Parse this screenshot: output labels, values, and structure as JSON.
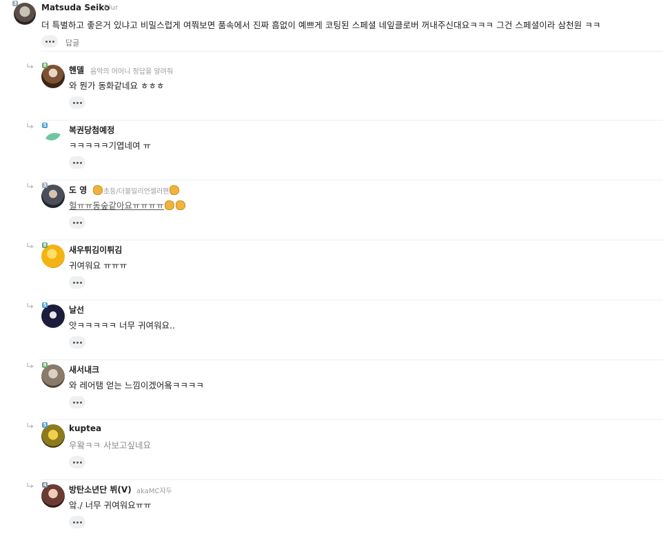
{
  "parent": {
    "nickname": "Matsuda Seiko",
    "nick_tag": "Blur",
    "level": "3",
    "text": "더 특별하고 좋은거 있냐고 비밀스럽게 여쭤보면 품속에서 진짜 흠없이 예쁘게 코팅된 스페셜 네잎클로버 꺼내주신대요ㅋㅋㅋ 그건 스페셜이라 삼천원 ㅋㅋ",
    "reply_label": "답글",
    "avatar_icon": "user-avatar"
  },
  "replies": [
    {
      "nickname": "헨델",
      "nick_tag": "음악의 어머니 정답을 알려줘",
      "level": "8",
      "text": "와 뭔가 동화같네요 ㅎㅎㅎ",
      "avatar_color": "#5a3a22",
      "avatar_icon": "user-avatar"
    },
    {
      "nickname": "복권당첨예정",
      "nick_tag": "",
      "level": "5",
      "text": "ㅋㅋㅋㅋㅋ기엽네여 ㅠ",
      "avatar_color": "#6fc7a1",
      "avatar_icon": "leaf-avatar"
    },
    {
      "nickname": "도 영",
      "nick_tag": "초등/더블밀리언셀러팬",
      "level": "3",
      "text": "헐ㅠㅠ동숲같아요ㅠㅠㅠㅠ",
      "avatar_color": "#3a3f4a",
      "avatar_icon": "user-avatar"
    },
    {
      "nickname": "새우튀김이튀김",
      "nick_tag": "",
      "level": "8",
      "text": "귀여워요 ㅠㅠㅠ",
      "avatar_color": "#f4b315",
      "avatar_icon": "user-avatar"
    },
    {
      "nickname": "날선",
      "nick_tag": "",
      "level": "5",
      "text": "앗ㅋㅋㅋㅋㅋ 너무 귀여워요..",
      "avatar_color": "#1b1d3a",
      "avatar_icon": "user-avatar"
    },
    {
      "nickname": "새서내크",
      "nick_tag": "",
      "level": "8",
      "text": "와 레어탬 얻는 느낌이겠어욬ㅋㅋㅋㅋ",
      "avatar_color": "#8a7a6a",
      "avatar_icon": "user-avatar"
    },
    {
      "nickname": "kuptea",
      "nick_tag": "",
      "level": "5",
      "text": "우왘ㅋㅋ 사보고싶네요",
      "avatar_color": "#8c7a1e",
      "avatar_icon": "user-avatar"
    },
    {
      "nickname": "방탄소년단 뷔(V)",
      "nick_tag": "akaMC자두",
      "level": "4",
      "text": "앜./ 너무 귀여워요ㅠㅠ",
      "avatar_color": "#6b3c33",
      "avatar_icon": "user-avatar"
    }
  ],
  "colors": {
    "divider": "#eceef0",
    "muted_text": "#9a9a9a",
    "more_button_bg": "#eff0f2"
  }
}
